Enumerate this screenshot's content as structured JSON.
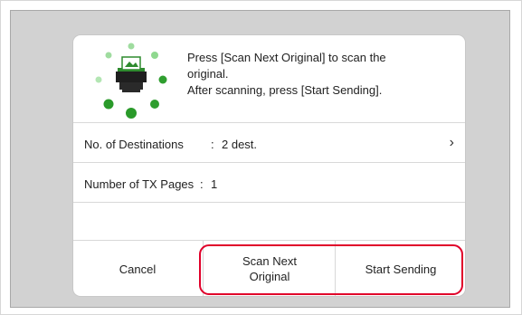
{
  "message": {
    "line1": "Press [Scan Next Original] to scan the",
    "line2": "original.",
    "line3": "After scanning, press [Start Sending]."
  },
  "destinations": {
    "label": "No. of Destinations",
    "separator": ":",
    "value": "2 dest.",
    "chevron": "›"
  },
  "tx_pages": {
    "label": "Number of TX Pages",
    "separator": ":",
    "value": "1"
  },
  "buttons": {
    "cancel": "Cancel",
    "scan_next_line1": "Scan Next",
    "scan_next_line2": "Original",
    "start_sending": "Start Sending"
  },
  "icons": {
    "scanner": "scanner-icon",
    "chevron": "chevron-right-icon"
  },
  "colors": {
    "highlight": "#e0002a",
    "dot_dark": "#2a9a2a",
    "dot_light": "#7fd07f",
    "lcd_background": "#d2d2d2"
  }
}
